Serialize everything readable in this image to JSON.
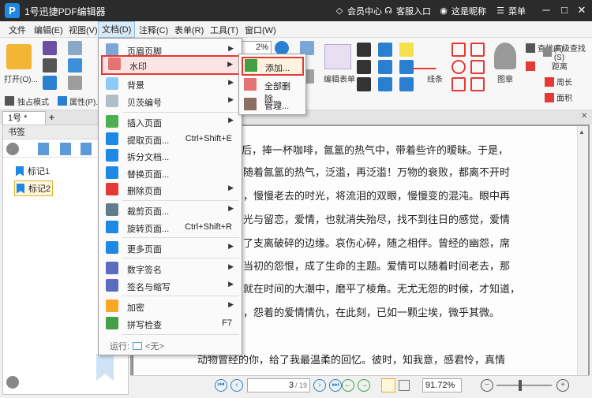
{
  "app": {
    "title": "1号迅捷PDF编辑器",
    "logo": "P",
    "member": "会员中心",
    "service": "客服入口",
    "user": "这是昵称",
    "menu": "菜单"
  },
  "menubar": [
    "文件",
    "编辑(E)",
    "视图(V)",
    "文档(D)",
    "注释(C)",
    "表单(R)",
    "工具(T)",
    "窗口(W)"
  ],
  "ribbon": {
    "open": "打开(O)...",
    "exclusive": "独占模式",
    "properties": "属性(P)...",
    "edit_form": "编辑表单",
    "lines": "线条",
    "stamp": "图章",
    "zoom_value": "2%",
    "find": "查找(F)",
    "adv_find": "高级查找(S)",
    "distance": "距离",
    "perimeter": "周长",
    "area": "面积"
  },
  "tab": {
    "name": "1号 *",
    "add": "+"
  },
  "bookmarks": {
    "header": "书签",
    "items": [
      "标记1",
      "标记2"
    ]
  },
  "document": {
    "lines": [
      "后，捧一杯咖啡，氤氲的热气中，带着些许的暧昧。于是，",
      "随着氤氲的热气，泛滥，再泛滥！万物的衰败，都离不开时",
      "，慢慢老去的时光，将流泪的双眼，慢慢变的混沌。眼中再",
      "光与留恋，爱情，也就消失殆尽，找不到往日的感觉，爱情",
      "了支离破碎的边缘。哀伤心碎，随之相伴。曾经的幽怨，席",
      "当初的怨恨，成了生命的主题。爱情可以随着时间老去，那",
      "就在时间的大潮中，磨平了棱角。无尤无怨的时候，才知道，",
      "，怨着的爱情情仇，在此刻，已如一颗尘埃，微乎其微。",
      "",
      "动物曾经的你，给了我最温柔的回忆。彼时，知我意，感君怜，真情"
    ]
  },
  "status": {
    "page": "3",
    "total": "/ 19",
    "zoom": "91.72%"
  },
  "dropdown": {
    "items": [
      {
        "label": "页眉页脚",
        "shortcut": "",
        "arrow": true
      },
      {
        "label": "水印",
        "shortcut": "",
        "arrow": true,
        "highlight": true
      },
      {
        "label": "背景",
        "shortcut": "",
        "arrow": true
      },
      {
        "label": "贝茨编号",
        "shortcut": "",
        "arrow": true
      },
      {
        "label": "插入页面",
        "shortcut": "",
        "arrow": true
      },
      {
        "label": "提取页面...",
        "shortcut": "Ctrl+Shift+E",
        "arrow": false
      },
      {
        "label": "拆分文档...",
        "shortcut": "",
        "arrow": false
      },
      {
        "label": "替换页面...",
        "shortcut": "",
        "arrow": false
      },
      {
        "label": "删除页面",
        "shortcut": "",
        "arrow": true
      },
      {
        "label": "裁剪页面...",
        "shortcut": "",
        "arrow": true
      },
      {
        "label": "旋转页面...",
        "shortcut": "Ctrl+Shift+R",
        "arrow": false
      },
      {
        "label": "更多页面",
        "shortcut": "",
        "arrow": true
      },
      {
        "label": "数字签名",
        "shortcut": "",
        "arrow": true
      },
      {
        "label": "签名与缩写",
        "shortcut": "",
        "arrow": true
      },
      {
        "label": "加密",
        "shortcut": "",
        "arrow": true
      },
      {
        "label": "拼写检查",
        "shortcut": "F7",
        "arrow": false
      }
    ],
    "run_label": "运行:",
    "run_value": "<无>"
  },
  "submenu": {
    "items": [
      "添加...",
      "全部删除...",
      "管理..."
    ]
  },
  "colors": {
    "titlebar": "#2b2b2b",
    "accent": "#1e88e5",
    "highlight": "#e53935"
  }
}
